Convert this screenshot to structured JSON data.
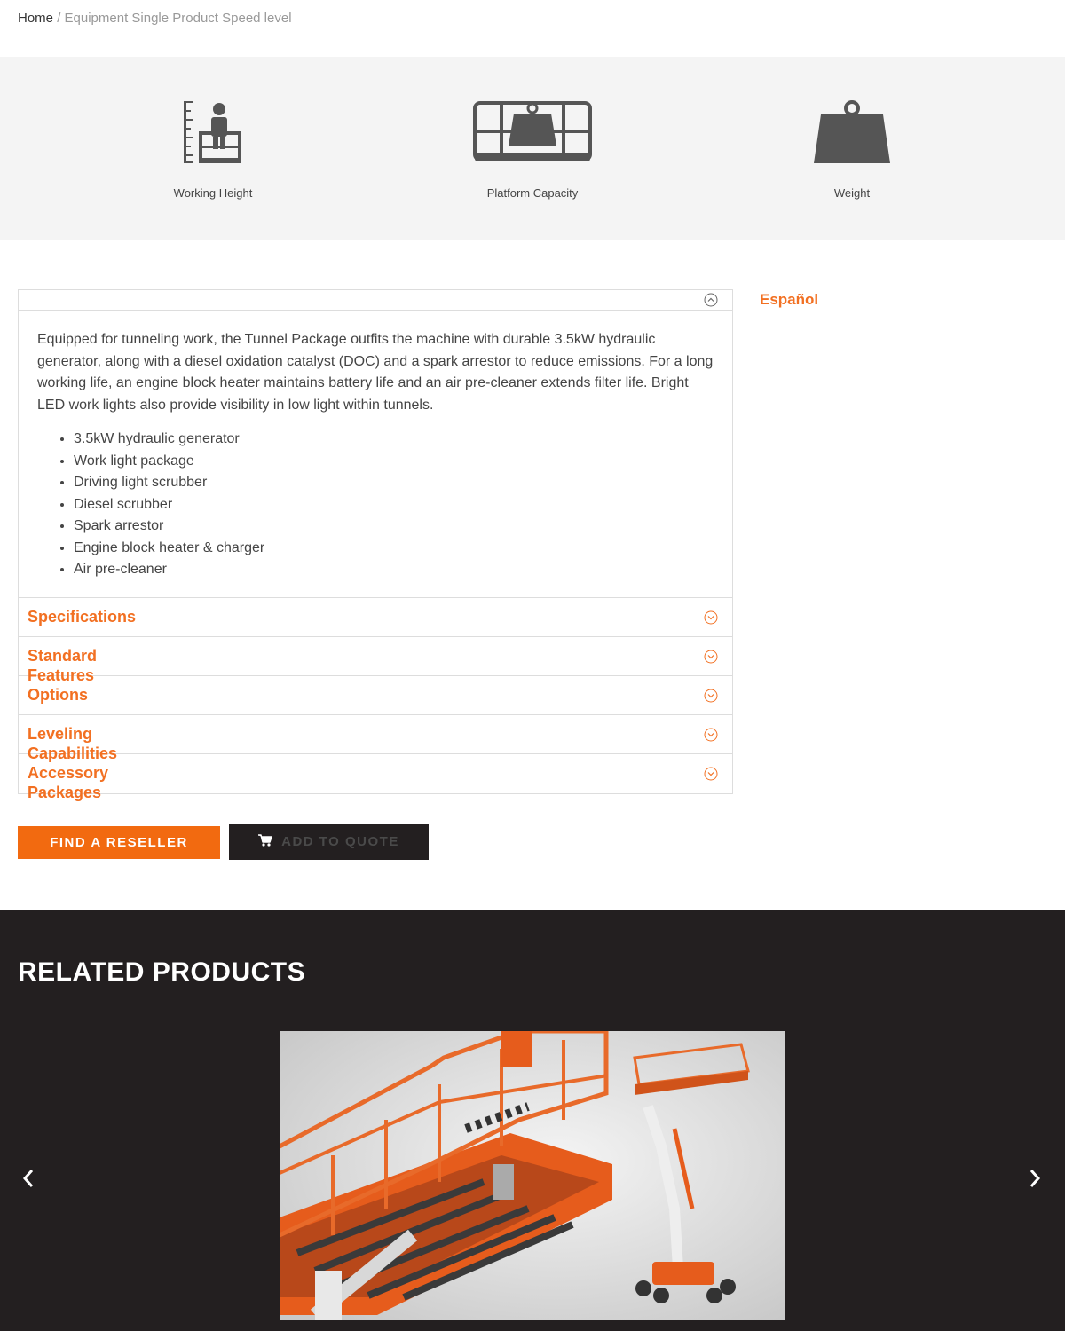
{
  "breadcrumb": {
    "home": "Home",
    "separator": "/",
    "current": "Equipment Single Product Speed level"
  },
  "specs": {
    "working_height": {
      "label": "Working Height",
      "icon": "working-height-icon"
    },
    "platform_capacity": {
      "label": "Platform Capacity",
      "icon": "platform-capacity-icon"
    },
    "weight": {
      "label": "Weight",
      "icon": "weight-icon"
    }
  },
  "description": {
    "paragraph": "Equipped for tunneling work, the Tunnel Package outfits the machine with durable 3.5kW hydraulic generator, along with a diesel oxidation catalyst (DOC) and a spark arrestor to reduce emissions. For a long working life, an engine block heater maintains battery life and an air pre-cleaner extends filter life. Bright LED work lights also provide visibility in low light within tunnels.",
    "features": [
      "3.5kW hydraulic generator",
      "Work light package",
      "Driving light scrubber",
      "Diesel scrubber",
      "Spark arrestor",
      "Engine block heater & charger",
      "Air pre-cleaner"
    ]
  },
  "accordion": [
    {
      "label": "Specifications"
    },
    {
      "label": "Standard Features"
    },
    {
      "label": "Options"
    },
    {
      "label": "Leveling Capabilities"
    },
    {
      "label": "Accessory Packages"
    }
  ],
  "language_link": "Español",
  "buttons": {
    "find_reseller": "FIND A RESELLER",
    "add_to_quote": "ADD TO QUOTE"
  },
  "related": {
    "title": "RELATED PRODUCTS"
  },
  "colors": {
    "accent": "#f27022",
    "dark": "#231f20",
    "strip": "#f4f4f4"
  }
}
